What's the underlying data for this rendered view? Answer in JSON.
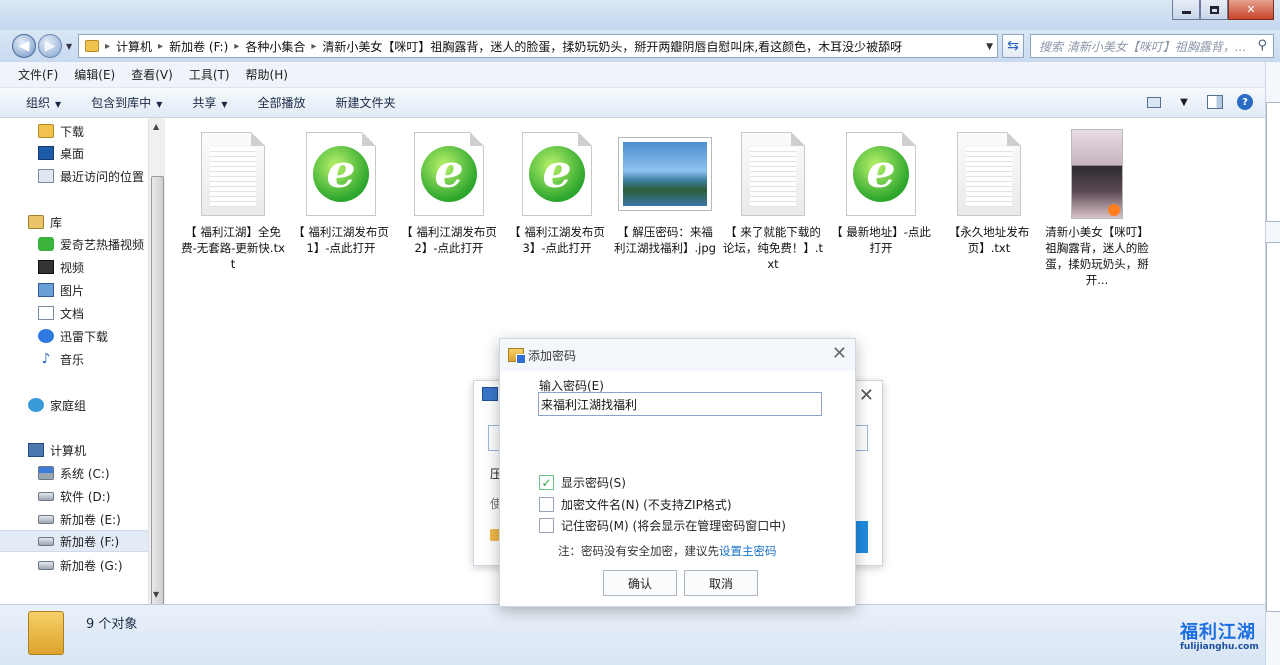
{
  "address": {
    "segments": [
      "计算机",
      "新加卷 (F:)",
      "各种小集合",
      "清新小美女【咪叮】祖胸露背，迷人的脸蛋，揉奶玩奶头，掰开两瓣阴唇自慰叫床,看这颜色，木耳没少被舔呀"
    ],
    "search_placeholder": "搜索 清新小美女【咪叮】祖胸露背，..."
  },
  "menu": [
    "文件(F)",
    "编辑(E)",
    "查看(V)",
    "工具(T)",
    "帮助(H)"
  ],
  "toolbar": [
    "组织",
    "包含到库中",
    "共享",
    "全部播放",
    "新建文件夹"
  ],
  "sidebar": [
    {
      "label": "下载",
      "icon": "download-folder-icon"
    },
    {
      "label": "桌面",
      "icon": "desktop-icon"
    },
    {
      "label": "最近访问的位置",
      "icon": "recent-places-icon"
    },
    {
      "label": "库",
      "icon": "library-icon"
    },
    {
      "label": "爱奇艺热播视频",
      "icon": "iqiyi-icon"
    },
    {
      "label": "视频",
      "icon": "video-icon"
    },
    {
      "label": "图片",
      "icon": "pictures-icon"
    },
    {
      "label": "文档",
      "icon": "documents-icon"
    },
    {
      "label": "迅雷下载",
      "icon": "xunlei-icon"
    },
    {
      "label": "音乐",
      "icon": "music-icon"
    },
    {
      "label": "家庭组",
      "icon": "homegroup-icon"
    },
    {
      "label": "计算机",
      "icon": "computer-icon"
    },
    {
      "label": "系统 (C:)",
      "icon": "system-drive-icon"
    },
    {
      "label": "软件 (D:)",
      "icon": "drive-icon"
    },
    {
      "label": "新加卷 (E:)",
      "icon": "drive-icon"
    },
    {
      "label": "新加卷 (F:)",
      "icon": "drive-icon"
    },
    {
      "label": "新加卷 (G:)",
      "icon": "drive-icon"
    }
  ],
  "files": [
    {
      "name": "【 福利江湖】全免费-无套路-更新快.txt",
      "type": "txt"
    },
    {
      "name": "【 福利江湖发布页1】-点此打开",
      "type": "ie"
    },
    {
      "name": "【 福利江湖发布页2】-点此打开",
      "type": "ie"
    },
    {
      "name": "【 福利江湖发布页3】-点此打开",
      "type": "ie"
    },
    {
      "name": "【 解压密码：来福利江湖找福利】.jpg",
      "type": "jpg"
    },
    {
      "name": "【 来了就能下载的论坛，纯免费！】.txt",
      "type": "txt"
    },
    {
      "name": "【 最新地址】-点此打开",
      "type": "ie"
    },
    {
      "name": "【永久地址发布页】.txt",
      "type": "txt"
    },
    {
      "name": "清新小美女【咪叮】祖胸露背，迷人的脸蛋，揉奶玩奶头，掰开...",
      "type": "video"
    }
  ],
  "status": {
    "count": "9 个对象"
  },
  "dialog": {
    "title": "添加密码",
    "input_label": "输入密码(E)",
    "input_value": "来福利江湖找福利",
    "show_password": "显示密码(S)",
    "encrypt_names": "加密文件名(N) (不支持ZIP格式)",
    "remember": "记住密码(M) (将会显示在管理密码窗口中)",
    "note": "注：密码没有安全加密，建议先",
    "note_link": "设置主密码",
    "ok": "确认",
    "cancel": "取消",
    "show_password_checked": true,
    "encrypt_names_checked": false,
    "remember_checked": false
  },
  "background_dialog": {
    "text1": "压",
    "text2": "使"
  },
  "watermark": {
    "title": "福利江湖",
    "url": "fulijianghu.com"
  }
}
